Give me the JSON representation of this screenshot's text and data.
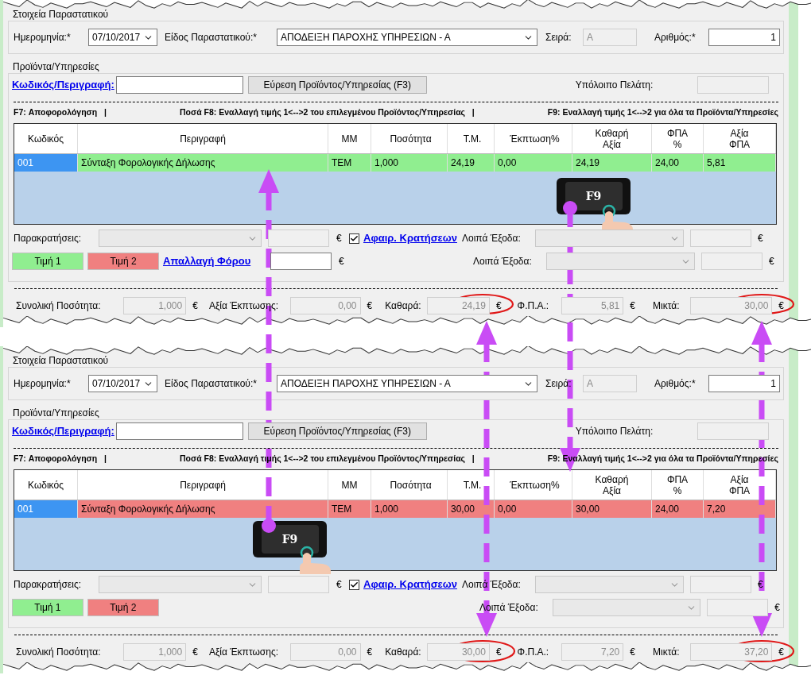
{
  "panels": [
    {
      "document_group": {
        "title": "Στοιχεία Παραστατικού",
        "date_label": "Ημερομηνία:*",
        "date_value": "07/10/2017",
        "type_label": "Είδος Παραστατικού:*",
        "type_value": "ΑΠΟΔΕΙΞΗ ΠΑΡΟΧΗΣ ΥΠΗΡΕΣΙΩΝ - Α",
        "series_label": "Σειρά:",
        "series_value": "Α",
        "number_label": "Αριθμός:*",
        "number_value": "1"
      },
      "products_group": {
        "title": "Προϊόντα/Υπηρεσίες",
        "code_link": "Κωδικός/Περιγραφή:",
        "find_button": "Εύρεση Προϊόντος/Υπηρεσίας (F3)",
        "balance_label": "Υπόλοιπο Πελάτη:",
        "shortcuts": [
          "F7: Αποφορολόγηση   |",
          "Ποσά F8: Εναλλαγή τιμής 1<-->2 του επιλεγμένου Προϊόντος/Υπηρεσίας   |",
          "F9: Εναλλαγή τιμής 1<-->2 για όλα τα Προϊόντα/Υπηρεσίες"
        ]
      },
      "table": {
        "columns": [
          "Κωδικός",
          "Περιγραφή",
          "ΜΜ",
          "Ποσότητα",
          "Τ.Μ.",
          "Έκπτωση%",
          "Καθαρή\nΑξία",
          "ΦΠΑ\n%",
          "Αξία\nΦΠΑ"
        ],
        "rows": [
          {
            "kind": "price1",
            "cells": [
              "001",
              "Σύνταξη Φορολογικής Δήλωσης",
              "ΤΕΜ",
              "1,000",
              "24,19",
              "0,00",
              "24,19",
              "24,00",
              "5,81"
            ]
          }
        ]
      },
      "withholding": {
        "label": "Παρακρατήσεις:",
        "currency": "€",
        "deduct_checked": true,
        "deduct_link": "Αφαιρ. Κρατήσεων",
        "other_label": "Λοιπά Έξοδα:",
        "other_currency": "€"
      },
      "price_buttons": [
        {
          "label": "Τιμή 1",
          "kind": "price1"
        },
        {
          "label": "Τιμή 2",
          "kind": "price2"
        }
      ],
      "exemption": {
        "link": "Απαλλαγή Φόρου",
        "currency": "€"
      },
      "other_expenses": {
        "label": "Λοιπά Έξοδα:",
        "currency": "€"
      },
      "totals": [
        {
          "label": "Συνολική Ποσότητα:",
          "value": "1,000",
          "currency": "€"
        },
        {
          "label": "Αξία Έκπτωσης:",
          "value": "0,00",
          "currency": "€"
        },
        {
          "label": "Καθαρά:",
          "value": "24,19",
          "currency": "€"
        },
        {
          "label": "Φ.Π.Α.:",
          "value": "5,81",
          "currency": "€"
        },
        {
          "label": "Μικτά:",
          "value": "30,00",
          "currency": "€"
        }
      ]
    },
    {
      "document_group": {
        "title": "Στοιχεία Παραστατικού",
        "date_label": "Ημερομηνία:*",
        "date_value": "07/10/2017",
        "type_label": "Είδος Παραστατικού:*",
        "type_value": "ΑΠΟΔΕΙΞΗ ΠΑΡΟΧΗΣ ΥΠΗΡΕΣΙΩΝ - Α",
        "series_label": "Σειρά:",
        "series_value": "Α",
        "number_label": "Αριθμός:*",
        "number_value": "1"
      },
      "products_group": {
        "title": "Προϊόντα/Υπηρεσίες",
        "code_link": "Κωδικός/Περιγραφή:",
        "find_button": "Εύρεση Προϊόντος/Υπηρεσίας (F3)",
        "balance_label": "Υπόλοιπο Πελάτη:",
        "shortcuts": [
          "F7: Αποφορολόγηση   |",
          "Ποσά F8: Εναλλαγή τιμής 1<-->2 του επιλεγμένου Προϊόντος/Υπηρεσίας   |",
          "F9: Εναλλαγή τιμής 1<-->2 για όλα τα Προϊόντα/Υπηρεσίες"
        ]
      },
      "table": {
        "columns": [
          "Κωδικός",
          "Περιγραφή",
          "ΜΜ",
          "Ποσότητα",
          "Τ.Μ.",
          "Έκπτωση%",
          "Καθαρή\nΑξία",
          "ΦΠΑ\n%",
          "Αξία\nΦΠΑ"
        ],
        "rows": [
          {
            "kind": "price2",
            "cells": [
              "001",
              "Σύνταξη Φορολογικής Δήλωσης",
              "ΤΕΜ",
              "1,000",
              "30,00",
              "0,00",
              "30,00",
              "24,00",
              "7,20"
            ]
          }
        ]
      },
      "withholding": {
        "label": "Παρακρατήσεις:",
        "currency": "€",
        "deduct_checked": true,
        "deduct_link": "Αφαιρ. Κρατήσεων",
        "other_label": "Λοιπά Έξοδα:",
        "other_currency": "€"
      },
      "price_buttons": [
        {
          "label": "Τιμή 1",
          "kind": "price1"
        },
        {
          "label": "Τιμή 2",
          "kind": "price2"
        }
      ],
      "other_expenses": {
        "label": "Λοιπά Έξοδα:",
        "currency": "€"
      },
      "totals": [
        {
          "label": "Συνολική Ποσότητα:",
          "value": "1,000",
          "currency": "€"
        },
        {
          "label": "Αξία Έκπτωσης:",
          "value": "0,00",
          "currency": "€"
        },
        {
          "label": "Καθαρά:",
          "value": "30,00",
          "currency": "€"
        },
        {
          "label": "Φ.Π.Α.:",
          "value": "7,20",
          "currency": "€"
        },
        {
          "label": "Μικτά:",
          "value": "37,20",
          "currency": "€"
        }
      ]
    }
  ],
  "annotations": {
    "keys": [
      {
        "label": "F9"
      },
      {
        "label": "F9"
      }
    ]
  }
}
